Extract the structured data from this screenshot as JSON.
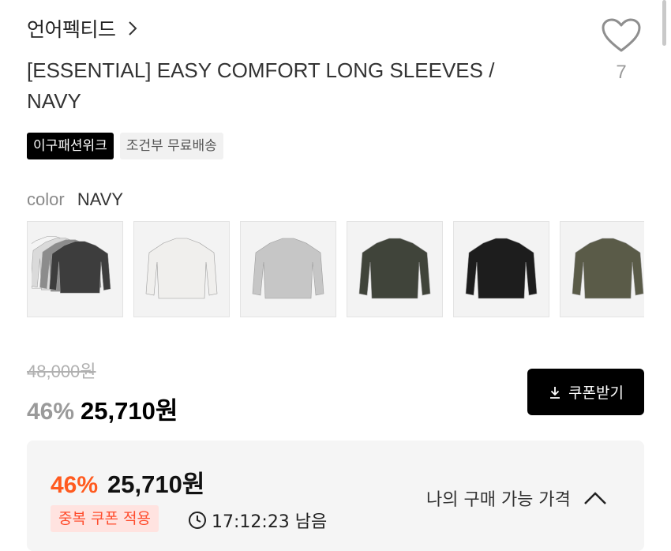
{
  "brand": {
    "name": "언어펙티드"
  },
  "product": {
    "title": "[ESSENTIAL] EASY COMFORT LONG SLEEVES / NAVY"
  },
  "like": {
    "count": "7"
  },
  "tags": [
    {
      "label": "이구패션위크",
      "style": "dark"
    },
    {
      "label": "조건부 무료배송",
      "style": "light"
    }
  ],
  "color": {
    "label": "color",
    "value": "NAVY"
  },
  "swatches": [
    {
      "name": "multi",
      "colors": [
        "#f4f4f4",
        "#dadada",
        "#8c8c8c",
        "#3d3d3d"
      ]
    },
    {
      "name": "white",
      "colors": [
        "#f0efed"
      ]
    },
    {
      "name": "light-grey",
      "colors": [
        "#c6c6c6"
      ]
    },
    {
      "name": "khaki",
      "colors": [
        "#40443a"
      ]
    },
    {
      "name": "black",
      "colors": [
        "#1d1d1d"
      ]
    },
    {
      "name": "olive",
      "colors": [
        "#5a5b48"
      ]
    }
  ],
  "price": {
    "original": "48,000원",
    "discount": "46%",
    "sale": "25,710원",
    "coupon_button": "쿠폰받기"
  },
  "benefit": {
    "discount": "46%",
    "price": "25,710원",
    "badge": "중복 쿠폰 적용",
    "timer": "17:12:23 남음",
    "toggle_label": "나의 구매 가능 가격"
  },
  "colors": {
    "accent": "#ff5a1f",
    "badge_text": "#ff4d2e",
    "badge_bg": "#ffe3e0"
  }
}
